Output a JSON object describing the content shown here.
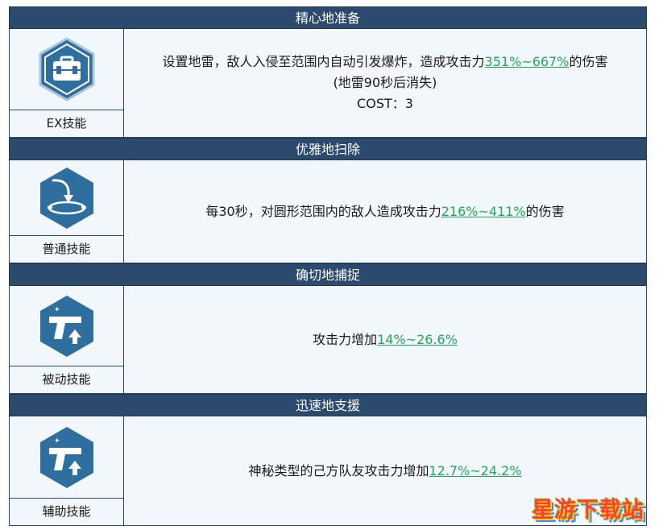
{
  "skills": [
    {
      "name": "精心地准备",
      "type": "EX技能",
      "icon": "briefcase-icon",
      "desc_lines": [
        {
          "pre": "设置地雷，敌人入侵至范围内自动引发爆炸，造成攻击力",
          "hl": "351%~667%",
          "post": "的伤害"
        },
        {
          "pre": "(地雷90秒后消失)",
          "hl": "",
          "post": ""
        },
        {
          "pre": "COST：3",
          "hl": "",
          "post": ""
        }
      ]
    },
    {
      "name": "优雅地扫除",
      "type": "普通技能",
      "icon": "target-drop-icon",
      "desc_lines": [
        {
          "pre": "每30秒，对圆形范围内的敌人造成攻击力",
          "hl": "216%~411%",
          "post": "的伤害"
        }
      ]
    },
    {
      "name": "确切地捕捉",
      "type": "被动技能",
      "icon": "pistol-up-icon",
      "desc_lines": [
        {
          "pre": "攻击力增加",
          "hl": "14%~26.6%",
          "post": ""
        }
      ]
    },
    {
      "name": "迅速地支援",
      "type": "辅助技能",
      "icon": "pistol-up-icon",
      "desc_lines": [
        {
          "pre": "神秘类型的己方队友攻击力增加",
          "hl": "12.7%~24.2%",
          "post": ""
        }
      ]
    }
  ],
  "watermark": "星游下载站",
  "colors": {
    "header_bg": "#2b4a6e",
    "cell_bg": "#f2f7fc",
    "highlight": "#22a85a",
    "icon_bg": "#2f6f9f"
  }
}
